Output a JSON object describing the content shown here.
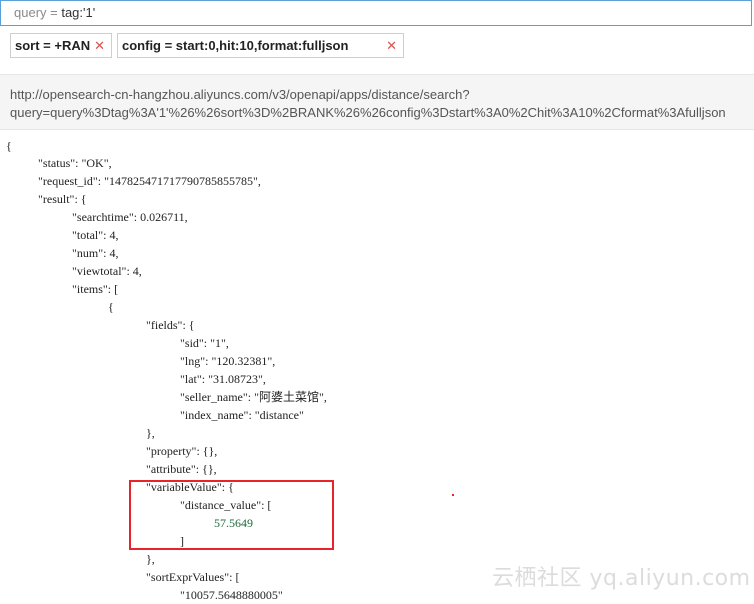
{
  "query_bar": {
    "label": "query = ",
    "value": "tag:'1'"
  },
  "chips": [
    {
      "text": "sort = +RAN",
      "close": "✕"
    },
    {
      "text": "config = start:0,hit:10,format:fulljson",
      "close": "✕"
    }
  ],
  "url": {
    "line1": "http://opensearch-cn-hangzhou.aliyuncs.com/v3/openapi/apps/distance/search?",
    "line2": "query=query%3Dtag%3A'1'%26%26sort%3D%2BRANK%26%26config%3Dstart%3A0%2Chit%3A10%2Cformat%3Afulljson"
  },
  "json_lines": [
    "{",
    "\"status\": \"OK\",",
    "\"request_id\": \"147825471717790785855785\",",
    "\"result\": {",
    "\"searchtime\": 0.026711,",
    "\"total\": 4,",
    "\"num\": 4,",
    "\"viewtotal\": 4,",
    "\"items\": [",
    "{",
    "\"fields\": {",
    "\"sid\": \"1\",",
    "\"lng\": \"120.32381\",",
    "\"lat\": \"31.08723\",",
    "\"seller_name\": \"阿婆土菜馆\",",
    "\"index_name\": \"distance\"",
    "},",
    "\"property\": {},",
    "\"attribute\": {},",
    "\"variableValue\": {",
    "\"distance_value\": [",
    "57.5649",
    "]",
    "},",
    "\"sortExprValues\": [",
    "\"10057.5648880005\""
  ],
  "watermark": "云栖社区 yq.aliyun.com"
}
